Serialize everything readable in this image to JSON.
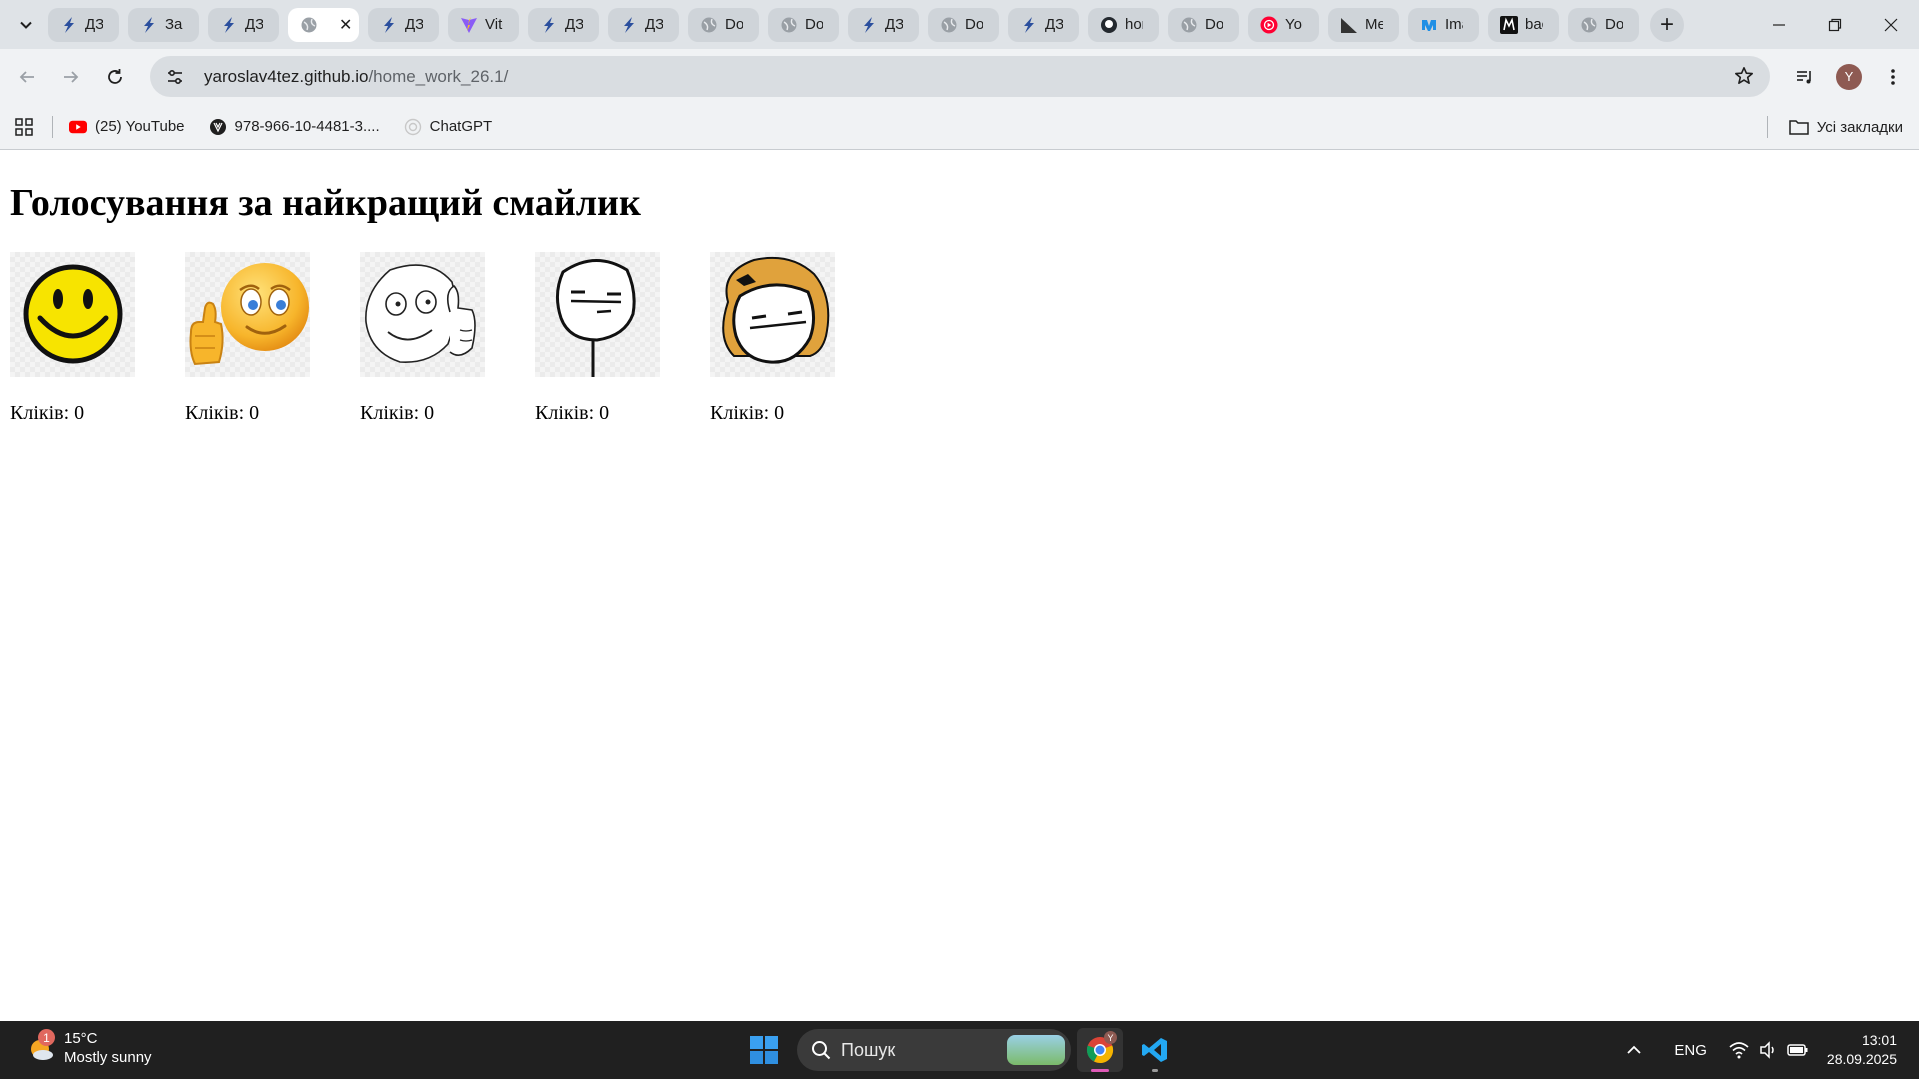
{
  "browser": {
    "tabs": [
      {
        "label": "ДЗ",
        "icon": "azure-devops-icon",
        "active": false
      },
      {
        "label": "Зан",
        "icon": "azure-devops-icon",
        "active": false
      },
      {
        "label": "ДЗ",
        "icon": "azure-devops-icon",
        "active": false
      },
      {
        "label": "",
        "icon": "globe-icon",
        "active": true
      },
      {
        "label": "ДЗ",
        "icon": "azure-devops-icon",
        "active": false
      },
      {
        "label": "Vite",
        "icon": "vite-icon",
        "active": false
      },
      {
        "label": "ДЗ",
        "icon": "azure-devops-icon",
        "active": false
      },
      {
        "label": "ДЗ",
        "icon": "azure-devops-icon",
        "active": false
      },
      {
        "label": "Doc",
        "icon": "globe-icon",
        "active": false
      },
      {
        "label": "Doc",
        "icon": "globe-icon",
        "active": false
      },
      {
        "label": "ДЗ",
        "icon": "azure-devops-icon",
        "active": false
      },
      {
        "label": "Doc",
        "icon": "globe-icon",
        "active": false
      },
      {
        "label": "ДЗ",
        "icon": "azure-devops-icon",
        "active": false
      },
      {
        "label": "hor",
        "icon": "github-icon",
        "active": false
      },
      {
        "label": "Doc",
        "icon": "globe-icon",
        "active": false
      },
      {
        "label": "You",
        "icon": "youtube-music-icon",
        "active": false
      },
      {
        "label": "Me",
        "icon": "medium-triangle-icon",
        "active": false
      },
      {
        "label": "Ima",
        "icon": "image-app-icon",
        "active": false
      },
      {
        "label": "bac",
        "icon": "m-logo-icon",
        "active": false
      },
      {
        "label": "Doc",
        "icon": "globe-icon",
        "active": false
      }
    ],
    "url_host": "yaroslav4tez.github.io",
    "url_path": "/home_work_26.1/",
    "profile_initial": "Y",
    "bookmarks": [
      {
        "label": "(25) YouTube",
        "icon": "youtube-icon"
      },
      {
        "label": "978-966-10-4481-3....",
        "icon": "book-icon"
      },
      {
        "label": "ChatGPT",
        "icon": "chatgpt-icon"
      }
    ],
    "all_bookmarks": "Усі закладки"
  },
  "page": {
    "title": "Голосування за найкращий смайлик",
    "smileys": [
      {
        "name": "classic-yellow-smiley",
        "clicks": "Кліків: 0"
      },
      {
        "name": "thumbs-up-emoji",
        "clicks": "Кліків: 0"
      },
      {
        "name": "rage-comic-thumbs-up",
        "clicks": "Кліків: 0"
      },
      {
        "name": "poker-face-meme",
        "clicks": "Кліків: 0"
      },
      {
        "name": "poker-face-girl-meme",
        "clicks": "Кліків: 0"
      }
    ]
  },
  "taskbar": {
    "weather_badge": "1",
    "temperature": "15°C",
    "condition": "Mostly sunny",
    "search_placeholder": "Пошук",
    "chrome_badge": "Y",
    "language": "ENG",
    "time": "13:01",
    "date": "28.09.2025"
  },
  "colors": {
    "tabstrip": "#dfe3e7",
    "toolbar": "#f0f2f4",
    "taskbar": "#202020"
  }
}
